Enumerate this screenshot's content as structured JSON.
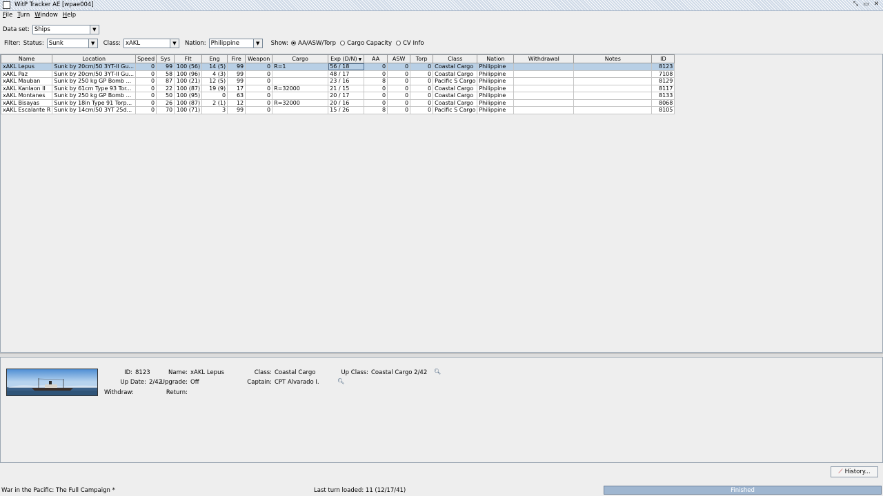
{
  "window": {
    "title": "WitP Tracker AE [wpae004]"
  },
  "menu": [
    {
      "key": "F",
      "rest": "ile"
    },
    {
      "key": "T",
      "rest": "urn"
    },
    {
      "key": "W",
      "rest": "indow"
    },
    {
      "key": "H",
      "rest": "elp"
    }
  ],
  "dataset": {
    "label": "Data set:",
    "value": "Ships"
  },
  "filter": {
    "label": "Filter:",
    "status_label": "Status:",
    "status_value": "Sunk",
    "class_label": "Class:",
    "class_value": "xAKL",
    "nation_label": "Nation:",
    "nation_value": "Philippine",
    "show_label": "Show:",
    "show_options": [
      "AA/ASW/Torp",
      "Cargo Capacity",
      "CV Info"
    ],
    "show_selected": "AA/ASW/Torp"
  },
  "table": {
    "columns": [
      "Name",
      "Location",
      "Speed",
      "Sys",
      "Flt",
      "Eng",
      "Fire",
      "Weapon",
      "Cargo",
      "Exp (D/N)",
      "AA",
      "ASW",
      "Torp",
      "Class",
      "Nation",
      "Withdrawal",
      "Notes",
      "ID"
    ],
    "sorted_column": "Exp (D/N)",
    "rows": [
      [
        "xAKL Lepus",
        "Sunk by 20cm/50 3YT-II Gu...",
        "0",
        "99",
        "100 (56)",
        "14 (5)",
        "99",
        "0",
        "R=1",
        "56 / 18",
        "0",
        "0",
        "0",
        "Coastal Cargo",
        "Philippine",
        "",
        "",
        "8123"
      ],
      [
        "xAKL Paz",
        "Sunk by 20cm/50 3YT-II Gu...",
        "0",
        "58",
        "100 (96)",
        "4 (3)",
        "99",
        "0",
        "",
        "48 / 17",
        "0",
        "0",
        "0",
        "Coastal Cargo",
        "Philippine",
        "",
        "",
        "7108"
      ],
      [
        "xAKL Mauban",
        "Sunk by 250 kg GP Bomb ...",
        "0",
        "87",
        "100 (21)",
        "12 (5)",
        "99",
        "0",
        "",
        "23 / 16",
        "8",
        "0",
        "0",
        "Pacific S Cargo",
        "Philippine",
        "",
        "",
        "8129"
      ],
      [
        "xAKL Kanlaon II",
        "Sunk by 61cm Type 93 Tor...",
        "0",
        "22",
        "100 (87)",
        "19 (9)",
        "17",
        "0",
        "R=32000",
        "21 / 15",
        "0",
        "0",
        "0",
        "Coastal Cargo",
        "Philippine",
        "",
        "",
        "8117"
      ],
      [
        "xAKL Montanes",
        "Sunk by 250 kg GP Bomb ...",
        "0",
        "50",
        "100 (95)",
        "0",
        "63",
        "0",
        "",
        "20 / 17",
        "0",
        "0",
        "0",
        "Coastal Cargo",
        "Philippine",
        "",
        "",
        "8133"
      ],
      [
        "xAKL Bisayas",
        "Sunk by 18in Type 91 Torp...",
        "0",
        "26",
        "100 (87)",
        "2 (1)",
        "12",
        "0",
        "R=32000",
        "20 / 16",
        "0",
        "0",
        "0",
        "Coastal Cargo",
        "Philippine",
        "",
        "",
        "8068"
      ],
      [
        "xAKL Escalante R",
        "Sunk by 14cm/50 3YT 25d...",
        "0",
        "70",
        "100 (71)",
        "3",
        "99",
        "0",
        "",
        "15 / 26",
        "8",
        "0",
        "0",
        "Pacific S Cargo",
        "Philippine",
        "",
        "",
        "8105"
      ]
    ],
    "selected_row": 0
  },
  "detail": {
    "id_label": "ID:",
    "id_value": "8123",
    "name_label": "Name:",
    "name_value": "xAKL Lepus",
    "class_label": "Class:",
    "class_value": "Coastal Cargo",
    "upclass_label": "Up Class:",
    "upclass_value": "Coastal Cargo 2/42",
    "update_label": "Up Date:",
    "update_value": "2/42",
    "upgrade_label": "Upgrade:",
    "upgrade_value": "Off",
    "captain_label": "Captain:",
    "captain_value": "CPT Alvarado I.",
    "withdraw_label": "Withdraw:",
    "withdraw_value": "",
    "return_label": "Return:",
    "return_value": ""
  },
  "history_button": {
    "label": "History..."
  },
  "status": {
    "game": "War in the Pacific: The Full Campaign  *",
    "last_turn": "Last turn loaded: 11 (12/17/41)",
    "progress_text": "Finished",
    "progress": 1.0
  },
  "colors": {
    "selection": "#b8cfe5",
    "progress": "#9fb6d0"
  }
}
